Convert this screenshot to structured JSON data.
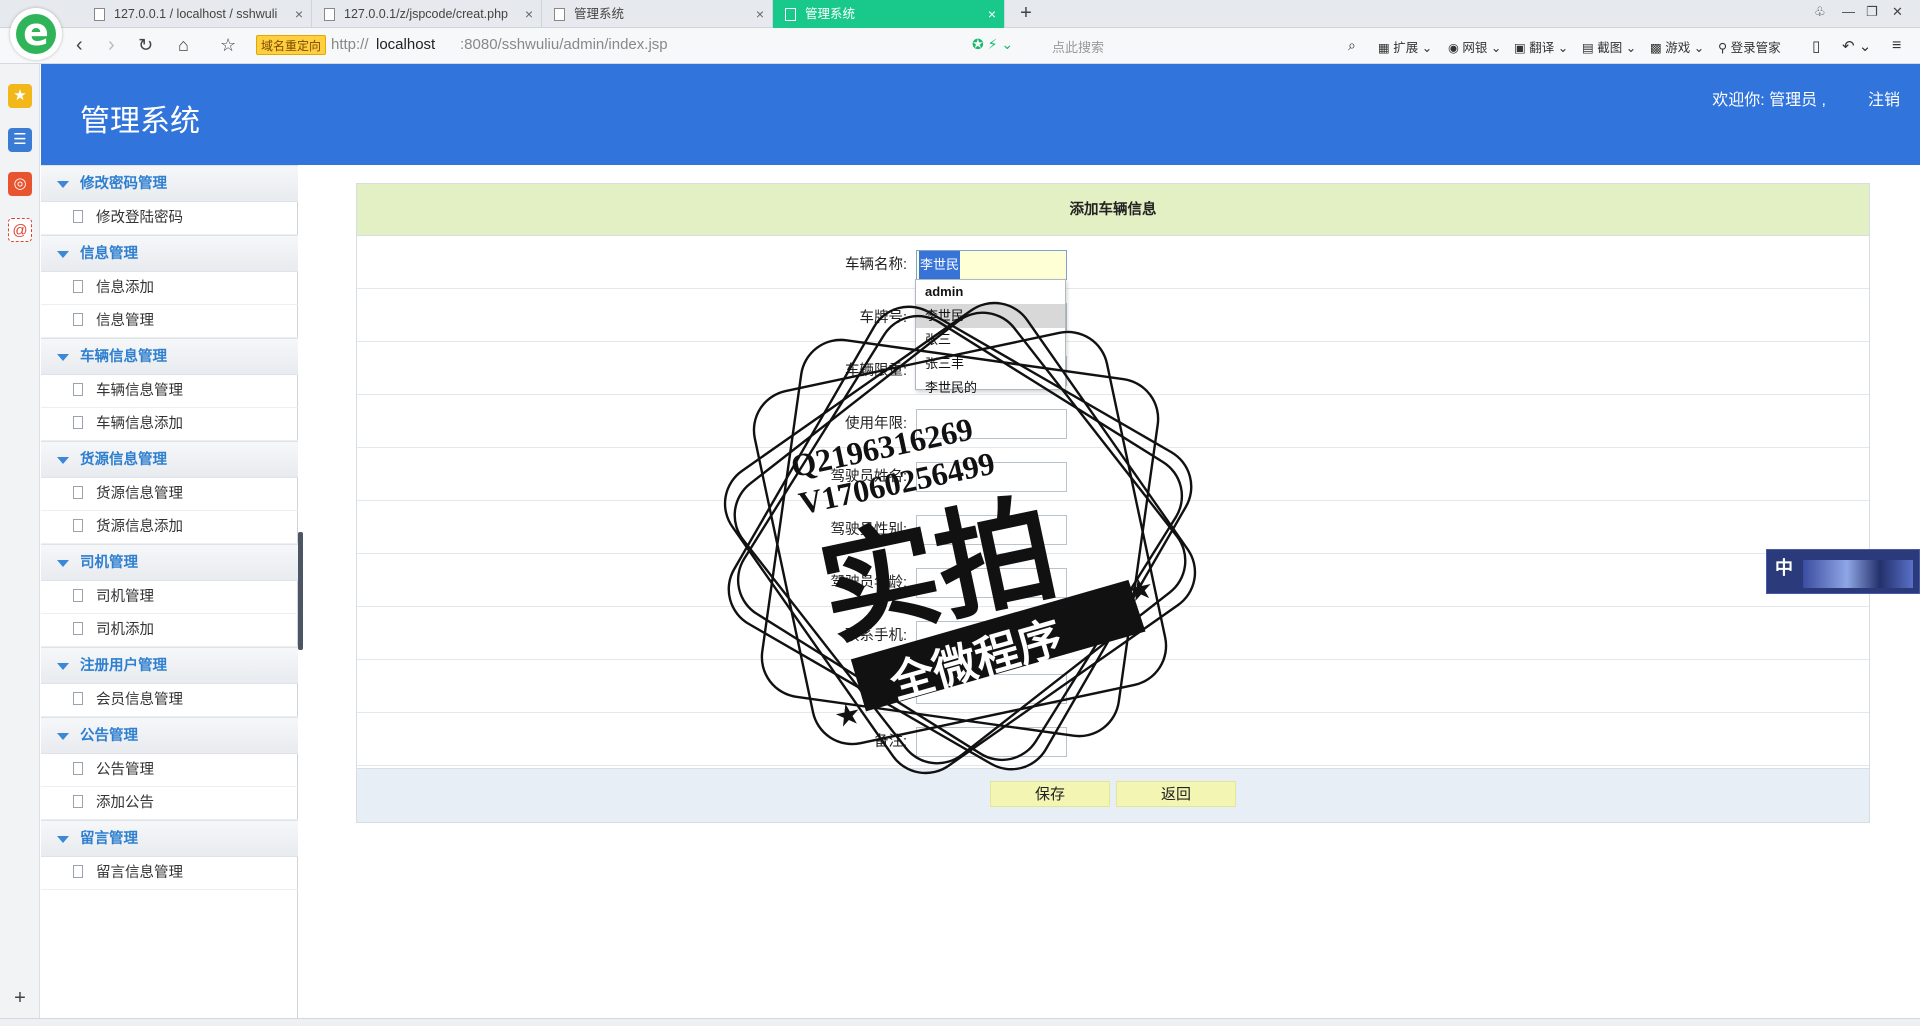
{
  "browser": {
    "tabs": [
      {
        "title": "127.0.0.1 / localhost / sshwuli",
        "active": false,
        "favicon": "phpmyadmin-icon"
      },
      {
        "title": "127.0.0.1/z/jspcode/creat.php",
        "active": false,
        "favicon": "page-icon"
      },
      {
        "title": "管理系统",
        "active": false,
        "favicon": "page-icon"
      },
      {
        "title": "管理系统",
        "active": true,
        "favicon": "page-icon"
      }
    ],
    "redirect_badge": "域名重定向",
    "url": {
      "prefix": "http://",
      "host": "localhost",
      "rest": ":8080/sshwuliu/admin/index.jsp"
    },
    "search_placeholder": "点此搜索",
    "toolbar": [
      "扩展",
      "网银",
      "翻译",
      "截图",
      "游戏",
      "登录管家"
    ],
    "accent_color": "#19c98c"
  },
  "app": {
    "title": "管理系统",
    "welcome": "欢迎你: 管理员 ,",
    "logout": "注销",
    "header_color": "#3174dc"
  },
  "menu": [
    {
      "title": "修改密码管理",
      "items": [
        "修改登陆密码"
      ]
    },
    {
      "title": "信息管理",
      "items": [
        "信息添加",
        "信息管理"
      ]
    },
    {
      "title": "车辆信息管理",
      "items": [
        "车辆信息管理",
        "车辆信息添加"
      ]
    },
    {
      "title": "货源信息管理",
      "items": [
        "货源信息管理",
        "货源信息添加"
      ]
    },
    {
      "title": "司机管理",
      "items": [
        "司机管理",
        "司机添加"
      ]
    },
    {
      "title": "注册用户管理",
      "items": [
        "会员信息管理"
      ]
    },
    {
      "title": "公告管理",
      "items": [
        "公告管理",
        "添加公告"
      ]
    },
    {
      "title": "留言管理",
      "items": [
        "留言信息管理"
      ]
    }
  ],
  "form": {
    "title": "添加车辆信息",
    "fields": [
      {
        "label": "车辆名称:",
        "value": "李世民",
        "focused": true
      },
      {
        "label": "车牌号:",
        "value": ""
      },
      {
        "label": "车辆限重:",
        "value": ""
      },
      {
        "label": "使用年限:",
        "value": ""
      },
      {
        "label": "驾驶员姓名:",
        "value": ""
      },
      {
        "label": "驾驶员性别:",
        "value": ""
      },
      {
        "label": "驾驶员年龄:",
        "value": ""
      },
      {
        "label": "联系手机:",
        "value": ""
      },
      {
        "label": "联系人:",
        "value": ""
      },
      {
        "label": "备注:",
        "value": ""
      }
    ],
    "buttons": {
      "save": "保存",
      "back": "返回"
    },
    "autocomplete": [
      "admin",
      "李世民",
      "张三",
      "张三丰",
      "李世民的"
    ]
  },
  "watermark": {
    "line1": "Q2196316269",
    "line2": "V17060256499",
    "main": "实拍",
    "banner": "全微程序"
  },
  "float_widget": {
    "label": "中"
  }
}
